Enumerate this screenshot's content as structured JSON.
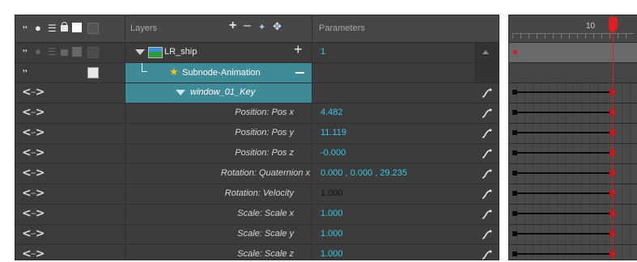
{
  "header": {
    "layers_label": "Layers",
    "parameters_label": "Parameters"
  },
  "rows": [
    {
      "layer_name": "LR_ship",
      "value": "1"
    },
    {
      "layer_name": "Subnode-Animation"
    },
    {
      "layer_name": "window_01_Key"
    },
    {
      "param": "Position: Pos x",
      "value": "4.482"
    },
    {
      "param": "Position: Pos y",
      "value": "11.119"
    },
    {
      "param": "Position: Pos z",
      "value": "-0.000"
    },
    {
      "param": "Rotation: Quaternion x",
      "value": "0.000 , 0.000 , 29.235"
    },
    {
      "param": "Rotation: Velocity",
      "value": "1.000"
    },
    {
      "param": "Scale: Scale x",
      "value": "1.000"
    },
    {
      "param": "Scale: Scale y",
      "value": "1.000"
    },
    {
      "param": "Scale: Scale z",
      "value": "1.000"
    }
  ],
  "timeline": {
    "frame_label": "10",
    "playhead_color": "#e02020"
  },
  "colors": {
    "selection": "#3f8a98",
    "value_text": "#39c6e6"
  },
  "icons": [
    "show-all-icon",
    "enable-icon",
    "lock-icon",
    "color-swatch-icon",
    "add-layer-icon",
    "remove-layer-icon",
    "add-peg-icon",
    "function-curve-icon"
  ]
}
